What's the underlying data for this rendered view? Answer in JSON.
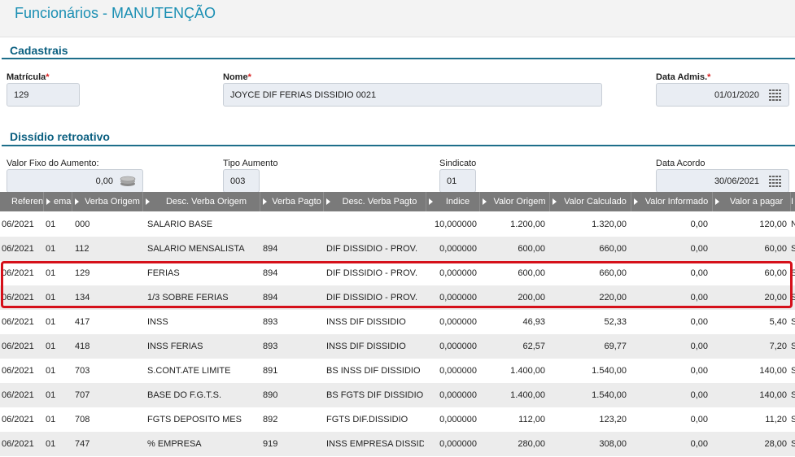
{
  "page": {
    "title": "Funcionários - MANUTENÇÃO"
  },
  "cadastrais": {
    "section_title": "Cadastrais",
    "matricula": {
      "label": "Matrícula",
      "value": "129"
    },
    "nome": {
      "label": "Nome",
      "value": "JOYCE DIF FERIAS DISSIDIO 0021"
    },
    "data_admis": {
      "label": "Data Admis.",
      "value": "01/01/2020"
    },
    "required_mark": "*"
  },
  "dissidio": {
    "section_title": "Dissídio retroativo",
    "valor_fixo": {
      "label": "Valor Fixo do Aumento:",
      "value": "0,00"
    },
    "tipo_aumento": {
      "label": "Tipo Aumento",
      "value": "003"
    },
    "sindicato": {
      "label": "Sindicato",
      "value": "01"
    },
    "data_acordo": {
      "label": "Data Acordo",
      "value": "30/06/2021"
    }
  },
  "grid": {
    "headers": [
      "Referen",
      "emai",
      "Verba Origem",
      "Desc. Verba Origem",
      "Verba Pagto",
      "Desc. Verba Pagto",
      "Indice",
      "Valor Origem",
      "Valor Calculado",
      "Valor Informado",
      "Valor a pagar",
      "I"
    ],
    "rows": [
      [
        "06/2021",
        "01",
        "000",
        "SALARIO BASE",
        "",
        "",
        "10,000000",
        "1.200,00",
        "1.320,00",
        "0,00",
        "120,00",
        "N"
      ],
      [
        "06/2021",
        "01",
        "112",
        "SALARIO MENSALISTA",
        "894",
        "DIF DISSIDIO - PROV.",
        "0,000000",
        "600,00",
        "660,00",
        "0,00",
        "60,00",
        "S"
      ],
      [
        "06/2021",
        "01",
        "129",
        "FERIAS",
        "894",
        "DIF DISSIDIO - PROV.",
        "0,000000",
        "600,00",
        "660,00",
        "0,00",
        "60,00",
        "S"
      ],
      [
        "06/2021",
        "01",
        "134",
        "1/3 SOBRE FERIAS",
        "894",
        "DIF DISSIDIO - PROV.",
        "0,000000",
        "200,00",
        "220,00",
        "0,00",
        "20,00",
        "S"
      ],
      [
        "06/2021",
        "01",
        "417",
        "INSS",
        "893",
        "INSS DIF DISSIDIO",
        "0,000000",
        "46,93",
        "52,33",
        "0,00",
        "5,40",
        "S"
      ],
      [
        "06/2021",
        "01",
        "418",
        "INSS FERIAS",
        "893",
        "INSS DIF DISSIDIO",
        "0,000000",
        "62,57",
        "69,77",
        "0,00",
        "7,20",
        "S"
      ],
      [
        "06/2021",
        "01",
        "703",
        "S.CONT.ATE LIMITE",
        "891",
        "BS INSS DIF DISSIDIO",
        "0,000000",
        "1.400,00",
        "1.540,00",
        "0,00",
        "140,00",
        "S"
      ],
      [
        "06/2021",
        "01",
        "707",
        "BASE DO F.G.T.S.",
        "890",
        "BS FGTS DIF DISSIDIO",
        "0,000000",
        "1.400,00",
        "1.540,00",
        "0,00",
        "140,00",
        "S"
      ],
      [
        "06/2021",
        "01",
        "708",
        "FGTS DEPOSITO MES",
        "892",
        "FGTS DIF.DISSIDIO",
        "0,000000",
        "112,00",
        "123,20",
        "0,00",
        "11,20",
        "S"
      ],
      [
        "06/2021",
        "01",
        "747",
        "% EMPRESA",
        "919",
        "INSS EMPRESA DISSIDI",
        "0,000000",
        "280,00",
        "308,00",
        "0,00",
        "28,00",
        "S"
      ]
    ]
  },
  "colors": {
    "title": "#1a8fb3",
    "section": "#0a5f80",
    "header_bg": "#7a7a7a",
    "highlight": "#d5101a"
  },
  "icons": {
    "calendar": "calendar-icon",
    "money": "money-icon",
    "sort": "sort-arrow-icon"
  }
}
